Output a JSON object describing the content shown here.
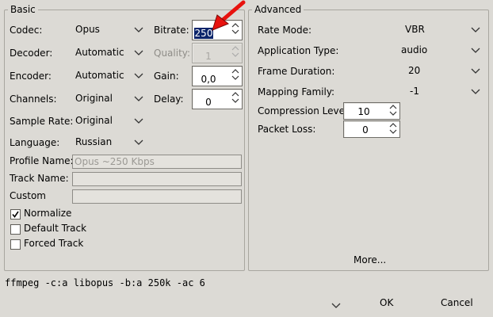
{
  "basic": {
    "title": "Basic",
    "codec": {
      "label": "Codec:",
      "value": "Opus"
    },
    "decoder": {
      "label": "Decoder:",
      "value": "Automatic"
    },
    "encoder": {
      "label": "Encoder:",
      "value": "Automatic"
    },
    "channels": {
      "label": "Channels:",
      "value": "Original"
    },
    "sample_rate": {
      "label": "Sample Rate:",
      "value": "Original"
    },
    "language": {
      "label": "Language:",
      "value": "Russian"
    },
    "bitrate": {
      "label": "Bitrate:",
      "value": "250"
    },
    "quality": {
      "label": "Quality:",
      "value": "1"
    },
    "gain": {
      "label": "Gain:",
      "value": "0,0"
    },
    "delay": {
      "label": "Delay:",
      "value": "0"
    },
    "profile_name": {
      "label": "Profile Name:",
      "placeholder": "Opus ~250 Kbps",
      "value": ""
    },
    "track_name": {
      "label": "Track Name:",
      "value": ""
    },
    "custom": {
      "label": "Custom",
      "value": ""
    },
    "normalize": {
      "label": "Normalize",
      "checked": true
    },
    "default_track": {
      "label": "Default Track",
      "checked": false
    },
    "forced_track": {
      "label": "Forced Track",
      "checked": false
    }
  },
  "advanced": {
    "title": "Advanced",
    "rate_mode": {
      "label": "Rate Mode:",
      "value": "VBR"
    },
    "application_type": {
      "label": "Application Type:",
      "value": "audio"
    },
    "frame_duration": {
      "label": "Frame Duration:",
      "value": "20"
    },
    "mapping_family": {
      "label": "Mapping Family:",
      "value": "-1"
    },
    "compression_level": {
      "label": "Compression Level:",
      "value": "10"
    },
    "packet_loss": {
      "label": "Packet Loss:",
      "value": "0"
    },
    "more_label": "More..."
  },
  "command_line": "ffmpeg -c:a libopus -b:a 250k -ac 6",
  "footer": {
    "ok_label": "OK",
    "cancel_label": "Cancel"
  },
  "annotation": {
    "color": "#e8120e"
  }
}
